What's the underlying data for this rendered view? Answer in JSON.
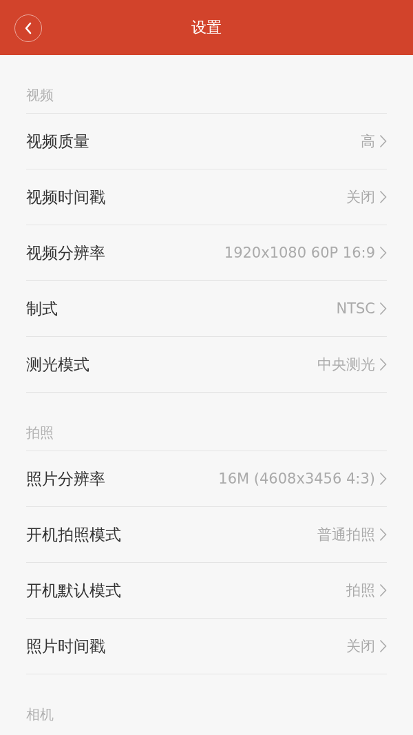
{
  "header": {
    "title": "设置"
  },
  "sections": [
    {
      "label": "视频",
      "rows": [
        {
          "label": "视频质量",
          "value": "高"
        },
        {
          "label": "视频时间戳",
          "value": "关闭"
        },
        {
          "label": "视频分辨率",
          "value": "1920x1080 60P 16:9"
        },
        {
          "label": "制式",
          "value": "NTSC"
        },
        {
          "label": "测光模式",
          "value": "中央测光"
        }
      ]
    },
    {
      "label": "拍照",
      "rows": [
        {
          "label": "照片分辨率",
          "value": "16M (4608x3456 4:3)"
        },
        {
          "label": "开机拍照模式",
          "value": "普通拍照"
        },
        {
          "label": "开机默认模式",
          "value": "拍照"
        },
        {
          "label": "照片时间戳",
          "value": "关闭"
        }
      ]
    },
    {
      "label": "相机"
    }
  ]
}
